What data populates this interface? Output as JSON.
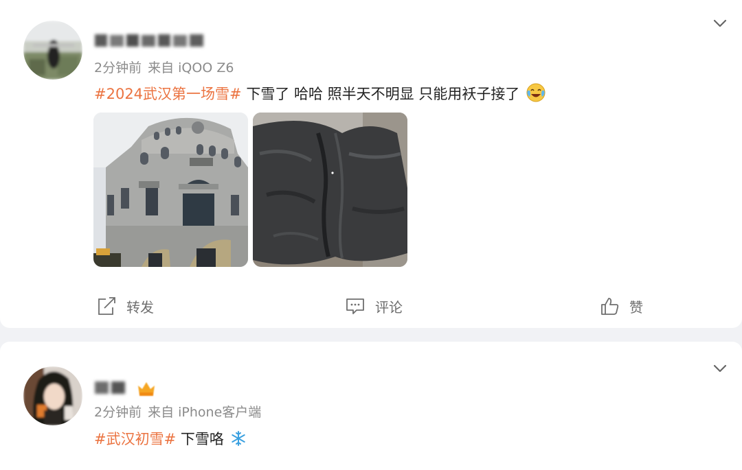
{
  "colors": {
    "topic": "#eb7340",
    "background": "#f1f2f5"
  },
  "posts": [
    {
      "username": "",
      "time": "2分钟前",
      "source": "来自 iQOO Z6",
      "topic": "#2024武汉第一场雪#",
      "body": " 下雪了 哈哈 照半天不明显 只能用袄子接了",
      "emoji_icon": "laugh-cry-emoji",
      "images": [
        "building-photo",
        "sleeve-photo"
      ],
      "actions": {
        "repost": "转发",
        "comment": "评论",
        "like": "赞"
      }
    },
    {
      "username": "",
      "time": "2分钟前",
      "source": "来自 iPhone客户端",
      "topic": "#武汉初雪#",
      "body": " 下雪咯",
      "emoji_icon": "snowflake-emoji",
      "badge_icon": "vip-crown-icon"
    }
  ]
}
